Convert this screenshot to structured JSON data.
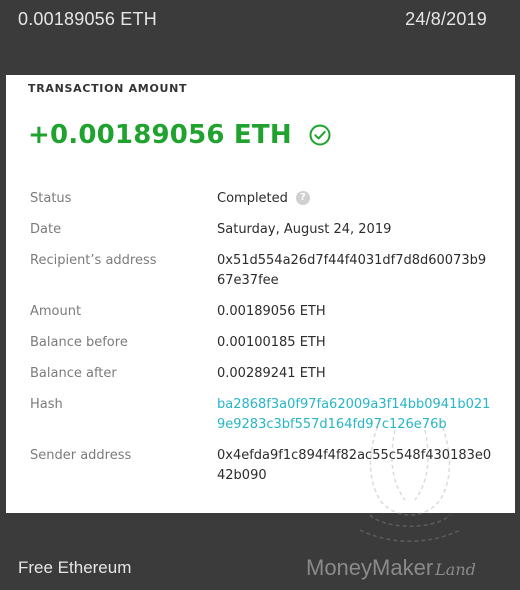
{
  "top_bar": {
    "amount": "0.00189056 ETH",
    "date": "24/8/2019"
  },
  "transaction": {
    "section_label": "TRANSACTION AMOUNT",
    "amount": "+0.00189056 ETH",
    "rows": [
      {
        "label": "Status",
        "value": "Completed"
      },
      {
        "label": "Date",
        "value": "Saturday, August 24, 2019"
      },
      {
        "label": "Recipient’s address",
        "value": "0x51d554a26d7f44f4031df7d8d60073b967e37fee"
      },
      {
        "label": "Amount",
        "value": "0.00189056 ETH"
      },
      {
        "label": "Balance before",
        "value": "0.00100185 ETH"
      },
      {
        "label": "Balance after",
        "value": "0.00289241 ETH"
      },
      {
        "label": "Hash",
        "value": "ba2868f3a0f97fa62009a3f14bb0941b0219e9283c3bf557d164fd97c126e76b"
      },
      {
        "label": "Sender address",
        "value": "0x4efda9f1c894f4f82ac55c548f430183e042b090"
      }
    ],
    "help_glyph": "?"
  },
  "footer": {
    "left_text": "Free Ethereum",
    "logo_main": "MoneyMaker",
    "logo_suffix": "Land"
  },
  "icons": {
    "status_check": "check-circle-icon",
    "status_help": "question-circle-icon"
  },
  "colors": {
    "page_bg": "#3b3b3b",
    "card_bg": "#ffffff",
    "amount_green": "#1fa22e",
    "link_teal": "#26b6c6",
    "label_gray": "#7b7b7b"
  }
}
